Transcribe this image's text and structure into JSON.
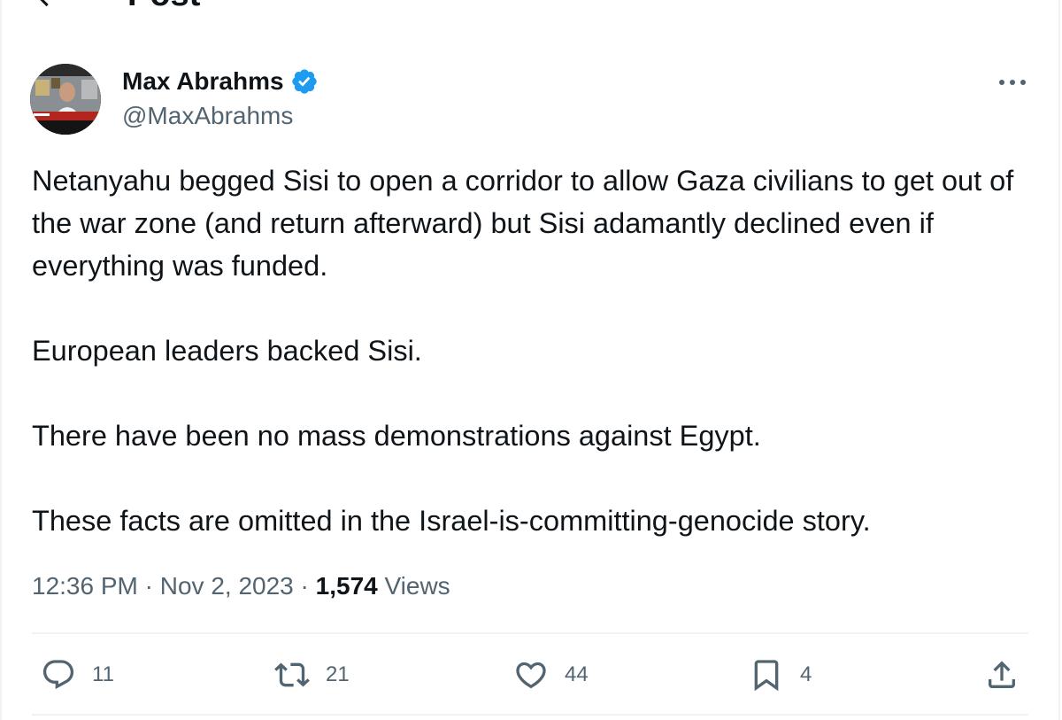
{
  "header": {
    "title": "Post",
    "back_icon": "arrow-left-icon"
  },
  "author": {
    "name": "Max Abrahms",
    "handle": "@MaxAbrahms",
    "verified": true,
    "verified_color": "#1d9bf0",
    "avatar_icon": "avatar-photo"
  },
  "tweet": {
    "paragraphs": [
      "Netanyahu begged Sisi to open a corridor to allow Gaza civilians to get out of the war zone (and return afterward) but Sisi adamantly declined even if everything was funded.",
      "European leaders backed Sisi.",
      "There have been no mass demonstrations against Egypt.",
      "These facts are omitted in the Israel-is-committing-genocide story."
    ]
  },
  "meta": {
    "time": "12:36 PM",
    "separator": " · ",
    "date": "Nov 2, 2023",
    "views_count": "1,574",
    "views_label": " Views"
  },
  "actions": {
    "replies": "11",
    "reposts": "21",
    "likes": "44",
    "bookmarks": "4"
  },
  "colors": {
    "text_primary": "#0f1419",
    "text_secondary": "#536471",
    "divider": "#eff3f4",
    "accent": "#1d9bf0"
  }
}
